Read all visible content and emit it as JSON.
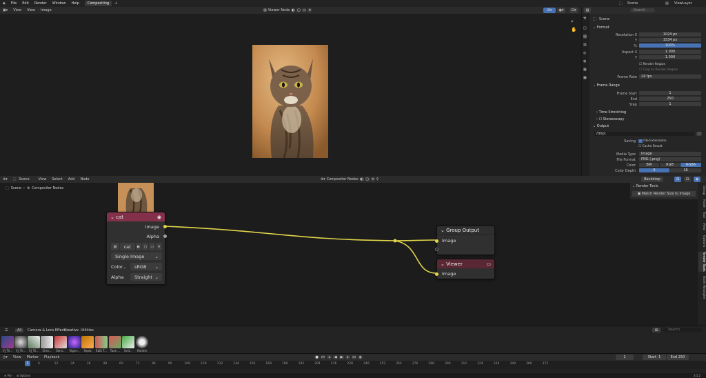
{
  "topbar": {
    "menus": [
      "File",
      "Edit",
      "Render",
      "Window",
      "Help"
    ],
    "workspace_tab": "Compositing",
    "add_tab": "+",
    "scene": "Scene",
    "view_layer": "ViewLayer"
  },
  "viewer": {
    "menus": [
      "View",
      "View",
      "Image"
    ],
    "node_name": "Viewer Node"
  },
  "props": {
    "scene_label": "Scene",
    "search_placeholder": "Search",
    "format_section": "Format",
    "resolution_x_label": "Resolution X",
    "resolution_x": "1024 px",
    "resolution_y_label": "Y",
    "resolution_y": "1534 px",
    "percent_label": "%",
    "percent": "100%",
    "aspect_x_label": "Aspect X",
    "aspect_x": "1.000",
    "aspect_y_label": "Y",
    "aspect_y": "1.000",
    "render_region": "Render Region",
    "crop_region": "Crop to Render Region",
    "frame_rate_label": "Frame Rate",
    "frame_rate": "24 fps",
    "frame_range_section": "Frame Range",
    "frame_start_label": "Frame Start",
    "frame_start": "1",
    "end_label": "End",
    "end": "250",
    "step_label": "Step",
    "step": "1",
    "time_stretching": "Time Stretching",
    "stereoscopy": "Stereoscopy",
    "output_section": "Output",
    "output_path": "/tmp\\",
    "saving_label": "Saving",
    "file_extensions": "File Extensions",
    "cache_result": "Cache Result",
    "media_type_label": "Media Type",
    "media_type": "Image",
    "file_format_label": "File Format",
    "file_format": "PNG (.png)",
    "color_label": "Color",
    "color_options": [
      "BW",
      "RGB",
      "RGBA"
    ],
    "color_depth_label": "Color Depth",
    "color_depth_options": [
      "8",
      "16"
    ]
  },
  "node_editor": {
    "scene": "Scene",
    "menus": [
      "View",
      "Select",
      "Add",
      "Node"
    ],
    "tree_name": "Compositor Nodes",
    "breadcrumb_scene": "Scene",
    "breadcrumb_tree": "Compositor Nodes",
    "backdrop": "Backdrop",
    "render_tools_header": "Render Tools",
    "match_render_size": "Match Render Size to Image",
    "side_tabs": [
      "Group",
      "Node",
      "Tool",
      "View",
      "Options",
      "Render Tools",
      "Node Wrangler"
    ]
  },
  "image_node": {
    "title": "cat",
    "out_image": "Image",
    "out_alpha": "Alpha",
    "image_name": "cat",
    "source": "Single Image",
    "colorspace_label": "Color...",
    "colorspace": "sRGB",
    "alpha_label": "Alpha",
    "alpha_mode": "Straight"
  },
  "group_output_node": {
    "title": "Group Output",
    "in_image": "Image"
  },
  "viewer_node": {
    "title": "Viewer",
    "in_image": "Image"
  },
  "asset_browser": {
    "tabs": [
      "All",
      "Camera & Lens Effects",
      "Creative",
      "Utilities"
    ],
    "search_placeholder": "Search",
    "items": [
      "VJ_Tri...",
      "VJ_Tri...",
      "VJ_Tri...",
      "Chro...",
      "Sens...",
      "Vigne...",
      "Sepia",
      "Split T...",
      "Tune ...",
      "Unit...",
      "Retime"
    ]
  },
  "timeline": {
    "menus": [
      "View",
      "Marker",
      "Playback"
    ],
    "current_frame": "1",
    "start_label": "Start",
    "start": "1",
    "end_label": "End",
    "end": "250",
    "ruler": [
      "1",
      "6",
      "12",
      "24",
      "36",
      "48",
      "60",
      "72",
      "84",
      "96",
      "108",
      "120",
      "132",
      "144",
      "156",
      "168",
      "180",
      "192",
      "204",
      "216",
      "228",
      "240",
      "252",
      "264",
      "276",
      "288",
      "300",
      "312",
      "324",
      "336",
      "348",
      "360",
      "372"
    ]
  },
  "statusbar": {
    "pan": "Pan",
    "options": "Options",
    "version": "3.5.2"
  },
  "colors": {
    "image_node_header": "#83314a",
    "viewer_node_header": "#5a2734",
    "link": "#e2d64a",
    "accent": "#4772b3"
  }
}
